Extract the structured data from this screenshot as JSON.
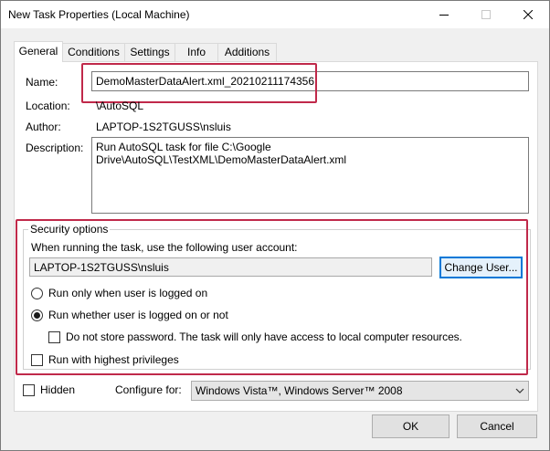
{
  "window": {
    "title": "New Task Properties (Local Machine)"
  },
  "tabs": [
    {
      "label": "General",
      "active": true
    },
    {
      "label": "Conditions",
      "active": false
    },
    {
      "label": "Settings",
      "active": false
    },
    {
      "label": "Info",
      "active": false
    },
    {
      "label": "Additions",
      "active": false
    }
  ],
  "general": {
    "name_label": "Name:",
    "name_value": "DemoMasterDataAlert.xml_20210211174356",
    "location_label": "Location:",
    "location_value": "\\AutoSQL",
    "author_label": "Author:",
    "author_value": "LAPTOP-1S2TGUSS\\nsluis",
    "description_label": "Description:",
    "description_value": "Run AutoSQL task for file C:\\Google Drive\\AutoSQL\\TestXML\\DemoMasterDataAlert.xml"
  },
  "security": {
    "group_title": "Security options",
    "account_prompt": "When running the task, use the following user account:",
    "account_value": "LAPTOP-1S2TGUSS\\nsluis",
    "change_user_label": "Change User...",
    "radio_logged_on": "Run only when user is logged on",
    "radio_whether": "Run whether user is logged on or not",
    "selected_radio": "whether",
    "no_store_password": "Do not store password.  The task will only have access to local computer resources.",
    "highest_privileges": "Run with highest privileges"
  },
  "bottom": {
    "hidden_label": "Hidden",
    "configure_label": "Configure for:",
    "configure_value": "Windows Vista™, Windows Server™ 2008"
  },
  "buttons": {
    "ok": "OK",
    "cancel": "Cancel"
  },
  "colors": {
    "highlight_red": "#c0294a",
    "focus_blue": "#0078d7"
  }
}
